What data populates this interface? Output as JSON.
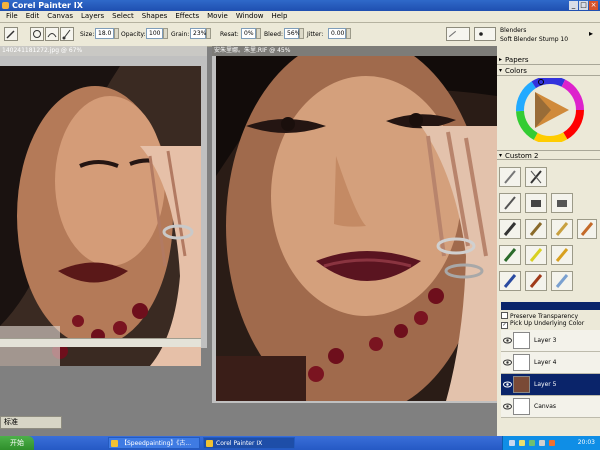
{
  "window": {
    "title": "Corel Painter IX"
  },
  "menu": [
    "File",
    "Edit",
    "Canvas",
    "Layers",
    "Select",
    "Shapes",
    "Effects",
    "Movie",
    "Window",
    "Help"
  ],
  "property_bar": {
    "size_label": "Size:",
    "size_value": "18.0",
    "opacity_label": "Opacity:",
    "opacity_value": "100",
    "grain_label": "Grain:",
    "grain_value": "23%",
    "resat_label": "Resat:",
    "resat_value": "0%",
    "bleed_label": "Bleed:",
    "bleed_value": "56%",
    "jitter_label": "Jitter:",
    "jitter_value": "0.00"
  },
  "brush_selector": {
    "category": "Blenders",
    "variant": "Soft Blender Stump 10"
  },
  "documents": [
    {
      "title": "140241181272.jpg @ 67%"
    },
    {
      "title": "安朱里娜。朱里.RIF @ 45%"
    }
  ],
  "panels": {
    "papers": "Papers",
    "colors": "Colors",
    "custom": "Custom 2"
  },
  "layers_panel": {
    "preserve_transparency": "Preserve Transparency",
    "pick_up_underlying": "Pick Up Underlying Color",
    "layers": [
      {
        "name": "Layer 3",
        "selected": false
      },
      {
        "name": "Layer 4",
        "selected": false
      },
      {
        "name": "Layer 5",
        "selected": true
      },
      {
        "name": "Canvas",
        "selected": false
      }
    ]
  },
  "ime_bar": {
    "mode": "标准"
  },
  "taskbar": {
    "start_label": "开始",
    "items": [
      {
        "label": "【Speedpainting】《古..."
      },
      {
        "label": "Corel Painter IX"
      }
    ],
    "clock": "20:03"
  },
  "colors": {
    "title_bar": "#1f4fb0",
    "selected_layer": "#0a246a",
    "taskbar": "#2559c4"
  }
}
